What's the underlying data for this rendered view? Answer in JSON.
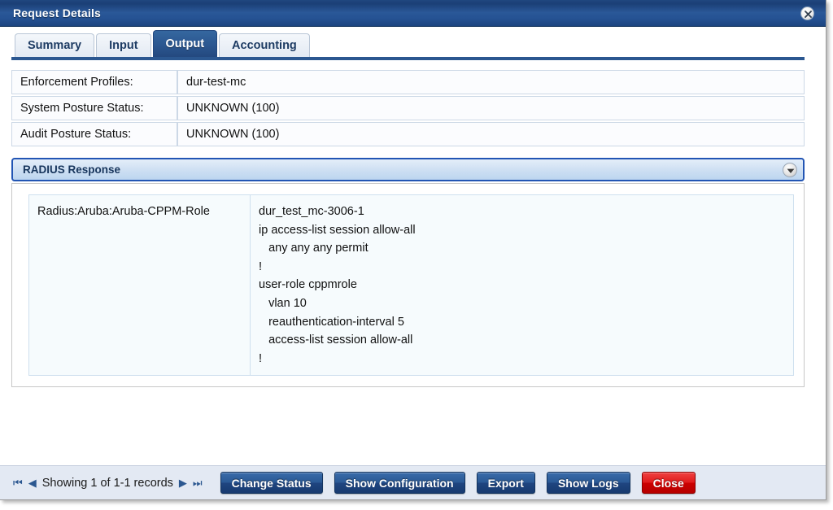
{
  "window": {
    "title": "Request Details",
    "close_icon": "close-icon"
  },
  "tabs": [
    {
      "label": "Summary",
      "active": false
    },
    {
      "label": "Input",
      "active": false
    },
    {
      "label": "Output",
      "active": true
    },
    {
      "label": "Accounting",
      "active": false
    }
  ],
  "summary_rows": [
    {
      "label": "Enforcement Profiles:",
      "value": "dur-test-mc"
    },
    {
      "label": "System Posture Status:",
      "value": "UNKNOWN (100)"
    },
    {
      "label": "Audit Posture Status:",
      "value": "UNKNOWN (100)"
    }
  ],
  "section": {
    "title": "RADIUS Response",
    "collapse_icon": "chevron-down-icon"
  },
  "attribute": {
    "name": "Radius:Aruba:Aruba-CPPM-Role",
    "value": "dur_test_mc-3006-1\nip access-list session allow-all\n   any any any permit\n!\nuser-role cppmrole\n   vlan 10\n   reauthentication-interval 5\n   access-list session allow-all\n!"
  },
  "footer": {
    "pager": {
      "first_icon": "first-page-icon",
      "prev_icon": "previous-page-icon",
      "text": "Showing 1 of 1-1 records",
      "next_icon": "next-page-icon",
      "last_icon": "last-page-icon"
    },
    "buttons": [
      {
        "label": "Change Status",
        "style": "primary"
      },
      {
        "label": "Show Configuration",
        "style": "primary"
      },
      {
        "label": "Export",
        "style": "primary"
      },
      {
        "label": "Show Logs",
        "style": "primary"
      },
      {
        "label": "Close",
        "style": "danger"
      }
    ]
  },
  "colors": {
    "titlebar_blue": "#2a5898",
    "active_tab_blue": "#2b5790",
    "section_border": "#2255b4",
    "footer_bg": "#e3e9f3",
    "danger_red": "#cc0000"
  }
}
